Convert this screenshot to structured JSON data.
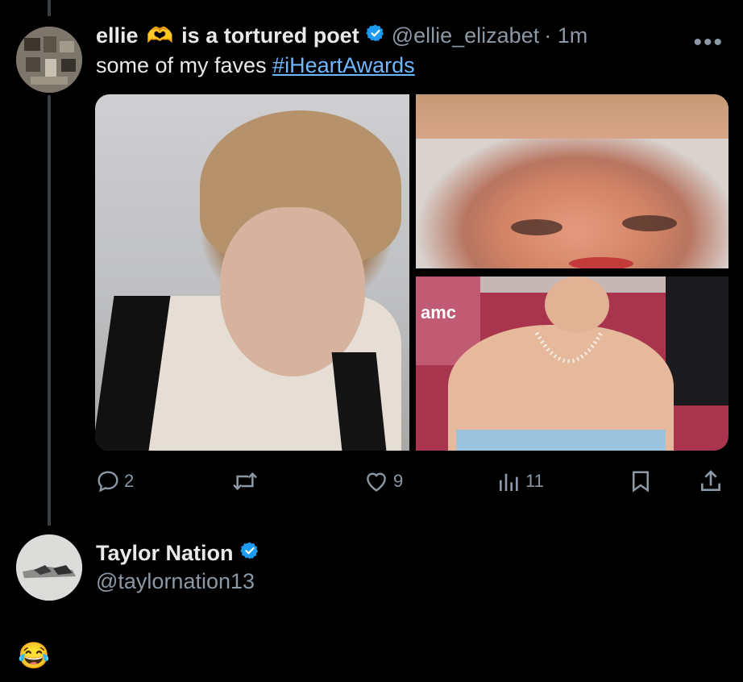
{
  "tweet": {
    "display_name": "ellie",
    "name_suffix": "is a tortured poet",
    "handle": "@ellie_elizabet",
    "time": "· 1m",
    "text": "some of my faves",
    "hashtag": "#iHeartAwards",
    "more_icon": "•••",
    "name_emoji": "🫶"
  },
  "stats": {
    "replies": "2",
    "retweets": "",
    "likes": "9",
    "views": "11"
  },
  "media": {
    "sign_text": "amc"
  },
  "reply": {
    "display_name": "Taylor Nation",
    "handle": "@taylornation13",
    "emoji": "😂"
  },
  "colors": {
    "background": "#000000",
    "text": "#e7e9ea",
    "muted": "#8b98a5",
    "link": "#6fb7ff",
    "verified": "#1d9bf0"
  }
}
